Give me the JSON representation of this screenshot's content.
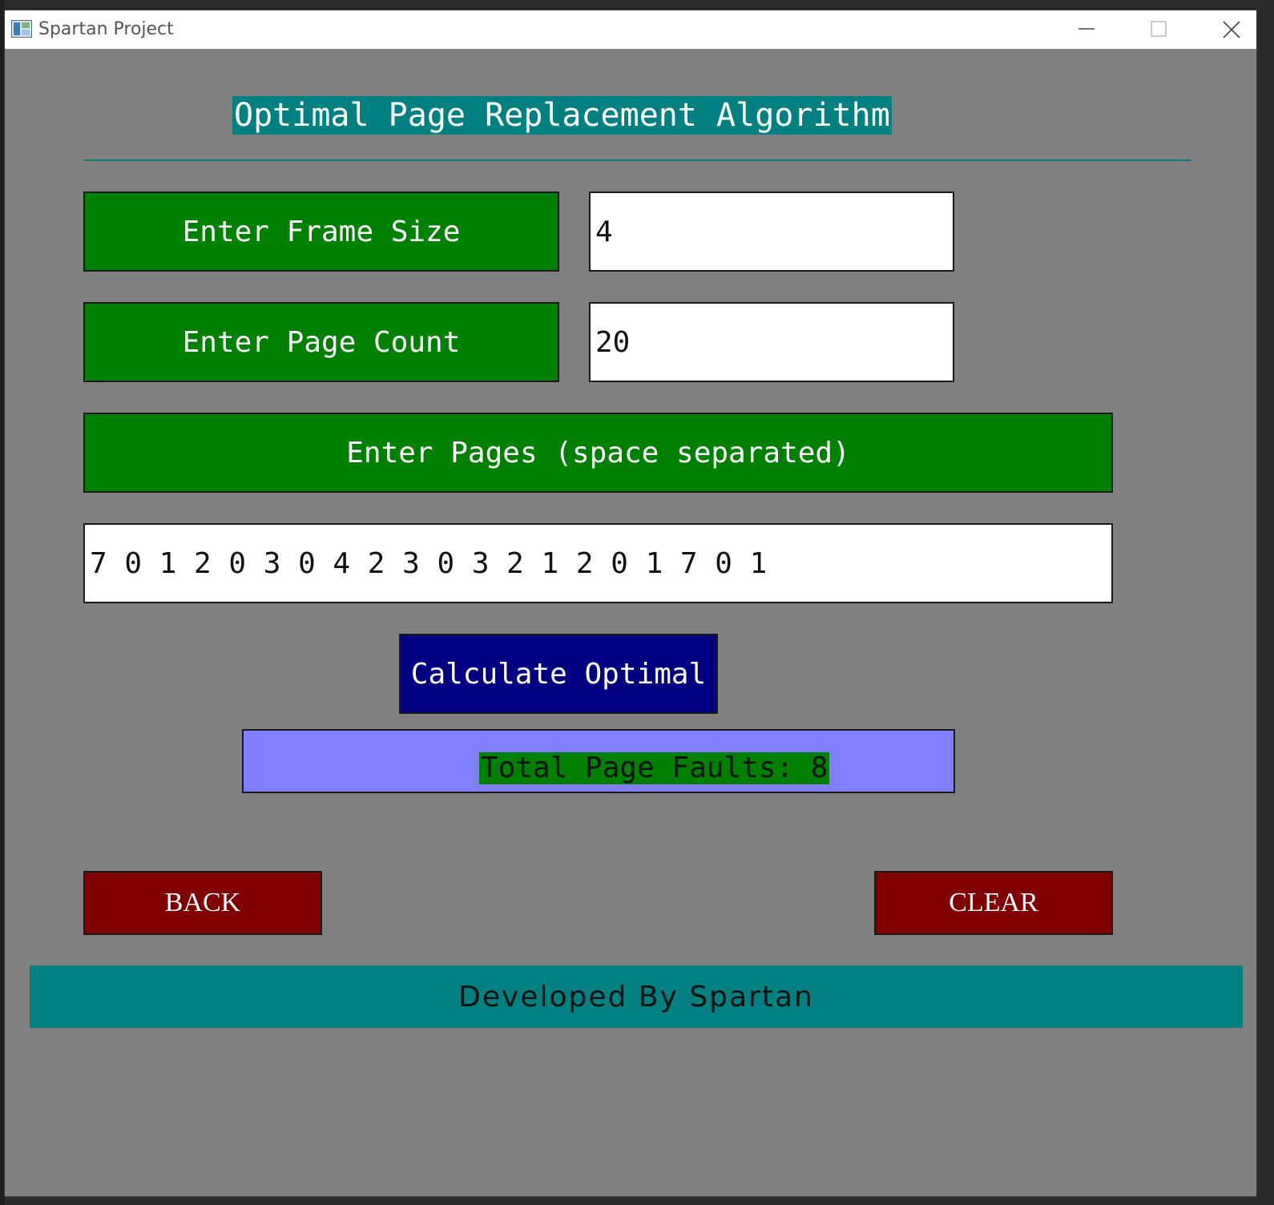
{
  "window": {
    "title": "Spartan Project"
  },
  "header": {
    "title": "Optimal Page Replacement Algorithm"
  },
  "form": {
    "frame_size_label": "Enter Frame Size",
    "frame_size_value": "4",
    "page_count_label": "Enter Page Count",
    "page_count_value": "20",
    "pages_label": "Enter Pages (space separated)",
    "pages_value": "7 0 1 2 0 3 0 4 2 3 0 3 2 1 2 0 1 7 0 1"
  },
  "actions": {
    "calculate_label": "Calculate Optimal",
    "back_label": "BACK",
    "clear_label": "CLEAR"
  },
  "result": {
    "text": "Total Page Faults: 8"
  },
  "footer": {
    "text": "Developed By Spartan"
  },
  "colors": {
    "background": "#808080",
    "heading": "#008080",
    "label": "#008000",
    "calculate": "#000080",
    "result": "#8080ff",
    "danger": "#800000"
  },
  "icons": {
    "app": "app-window-icon",
    "minimize": "minimize-icon",
    "maximize": "maximize-icon",
    "close": "close-icon"
  }
}
